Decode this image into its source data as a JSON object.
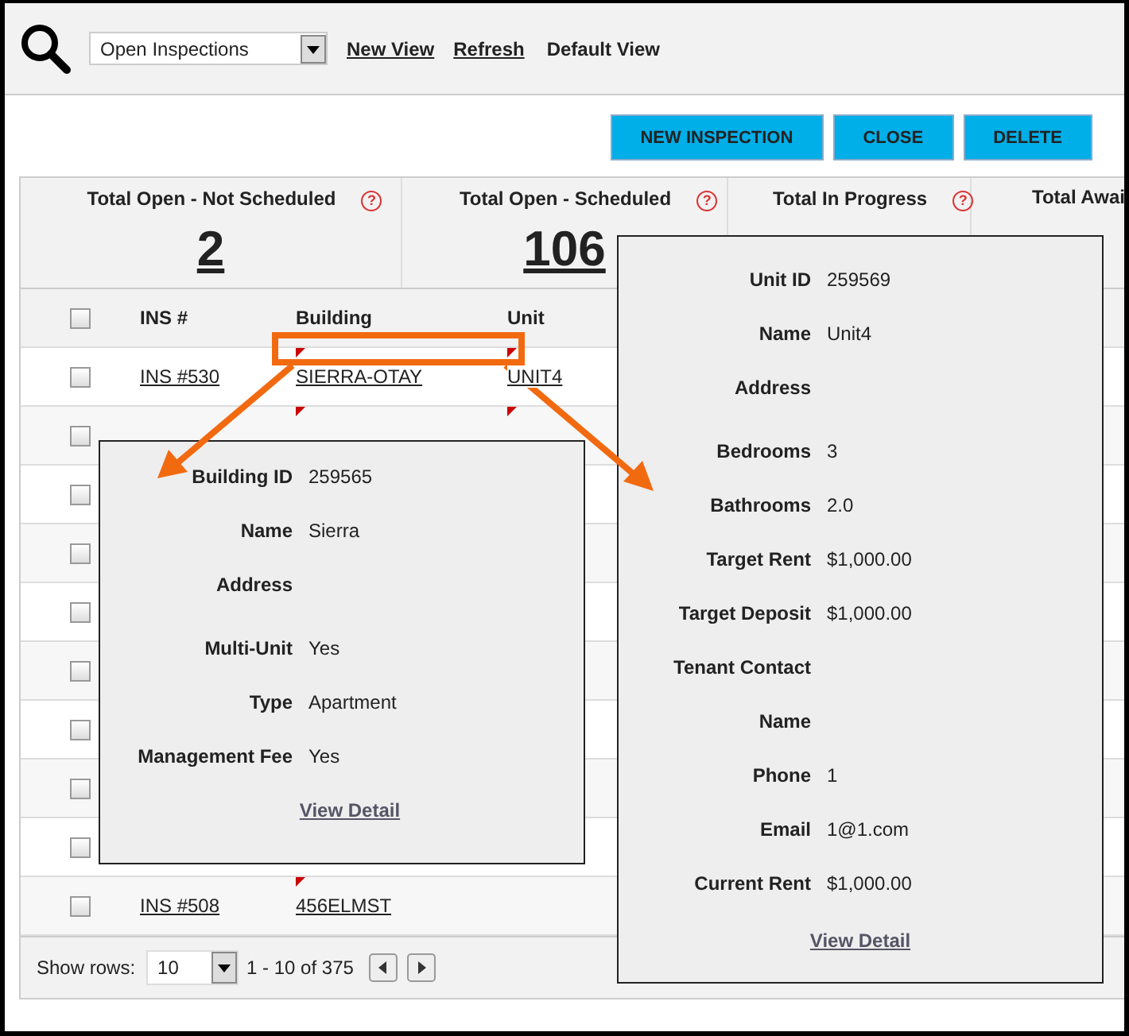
{
  "toolbar": {
    "view_select": "Open Inspections",
    "links": [
      "New View",
      "Refresh"
    ],
    "current_view": "Default View"
  },
  "actions": [
    "NEW INSPECTION",
    "CLOSE",
    "DELETE"
  ],
  "stats": [
    {
      "label": "Total Open - Not Scheduled",
      "help": "?",
      "value": "2"
    },
    {
      "label": "Total Open - Scheduled",
      "help": "?",
      "value": "106"
    },
    {
      "label": "Total In Progress",
      "help": "?"
    },
    {
      "label": "Total Awai"
    }
  ],
  "table": {
    "header_checked": false,
    "columns": [
      "INS #",
      "Building",
      "Unit"
    ],
    "rows": [
      {
        "checked": false,
        "ins": "INS #530",
        "building": "SIERRA-OTAY",
        "building_flag": true,
        "unit": "UNIT4",
        "unit_flag": true
      },
      {
        "checked": false,
        "building_flag": true,
        "unit_flag": true
      },
      {
        "checked": false
      },
      {
        "checked": false
      },
      {
        "checked": false
      },
      {
        "checked": false
      },
      {
        "checked": false
      },
      {
        "checked": false
      },
      {
        "checked": false
      },
      {
        "checked": false,
        "ins": "INS #508",
        "building": "456ELMST",
        "building_flag": true
      }
    ]
  },
  "footer": {
    "label": "Show rows:",
    "page_size": "10",
    "range": "1 - 10 of 375"
  },
  "building_popup": {
    "fields": [
      {
        "label": "Building ID",
        "value": "259565"
      },
      {
        "label": "Name",
        "value": "Sierra"
      },
      {
        "label": "Address"
      },
      {
        "label": "Multi-Unit",
        "value": "Yes"
      },
      {
        "label": "Type",
        "value": "Apartment"
      },
      {
        "label": "Management Fee",
        "value": "Yes"
      }
    ],
    "link": "View Detail"
  },
  "unit_popup": {
    "fields": [
      {
        "label": "Unit ID",
        "value": "259569"
      },
      {
        "label": "Name",
        "value": "Unit4"
      },
      {
        "label": "Address"
      },
      {
        "label": "Bedrooms",
        "value": "3"
      },
      {
        "label": "Bathrooms",
        "value": "2.0"
      },
      {
        "label": "Target Rent",
        "value": "$1,000.00"
      },
      {
        "label": "Target Deposit",
        "value": "$1,000.00"
      },
      {
        "label": "Tenant Contact"
      },
      {
        "label": "Name"
      },
      {
        "label": "Phone",
        "value": "1"
      },
      {
        "label": "Email",
        "value": "1@1.com"
      },
      {
        "label": "Current Rent",
        "value": "$1,000.00"
      }
    ],
    "link": "View Detail"
  }
}
